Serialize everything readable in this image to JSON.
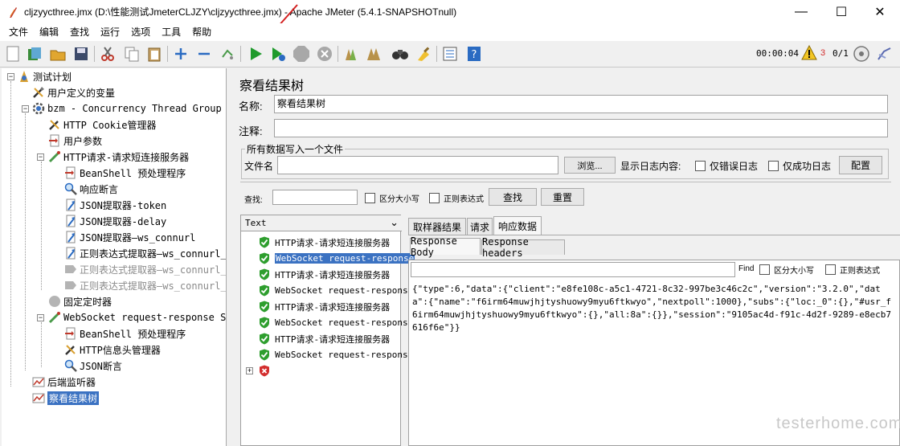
{
  "window": {
    "title": "cljzyycthree.jmx (D:\\性能测试JmeterCLJZY\\cljzyycthree.jmx) - Apache JMeter (5.4.1-SNAPSHOTnull)",
    "min": "—",
    "max": "☐",
    "close": "✕"
  },
  "menu": [
    "文件",
    "编辑",
    "查找",
    "运行",
    "选项",
    "工具",
    "帮助"
  ],
  "toolbar": {
    "timer": "00:00:04",
    "warning_count": "3",
    "threads": "0/1"
  },
  "tree": [
    {
      "label": "测试计划",
      "icon": "test-plan-icon"
    },
    {
      "label": "用户定义的变量",
      "icon": "wrench-icon"
    },
    {
      "label": "bzm - Concurrency Thread Group",
      "icon": "gear-icon"
    },
    {
      "label": "HTTP Cookie管理器",
      "icon": "wrench-icon"
    },
    {
      "label": "用户参数",
      "icon": "preprocessor-icon"
    },
    {
      "label": "HTTP请求-请求短连接服务器",
      "icon": "sampler-icon"
    },
    {
      "label": "BeanShell 预处理程序",
      "icon": "preprocessor-icon"
    },
    {
      "label": "响应断言",
      "icon": "magnifier-icon"
    },
    {
      "label": "JSON提取器-token",
      "icon": "postprocessor-icon"
    },
    {
      "label": "JSON提取器-delay",
      "icon": "postprocessor-icon"
    },
    {
      "label": "JSON提取器—ws_connurl",
      "icon": "postprocessor-icon"
    },
    {
      "label": "正则表达式提取器—ws_connurl_s",
      "icon": "postprocessor-icon"
    },
    {
      "label": "正则表达式提取器—ws_connurl_s",
      "icon": "postprocessor-disabled-icon"
    },
    {
      "label": "正则表达式提取器—ws_connurl_p",
      "icon": "postprocessor-disabled-icon"
    },
    {
      "label": "固定定时器",
      "icon": "timer-icon"
    },
    {
      "label": "WebSocket request-response Sampler",
      "icon": "sampler-icon"
    },
    {
      "label": "BeanShell 预处理程序",
      "icon": "preprocessor-icon"
    },
    {
      "label": "HTTP信息头管理器",
      "icon": "wrench-icon"
    },
    {
      "label": "JSON断言",
      "icon": "magnifier-icon"
    },
    {
      "label": "后端监听器",
      "icon": "listener-icon"
    },
    {
      "label": "察看结果树",
      "icon": "listener-icon"
    }
  ],
  "panel": {
    "title": "察看结果树",
    "name_label": "名称:",
    "name_value": "察看结果树",
    "comment_label": "注释:",
    "comment_value": "",
    "file_group": "所有数据写入一个文件",
    "filename_label": "文件名",
    "browse": "浏览...",
    "log_label": "显示日志内容:",
    "errors_only": "仅错误日志",
    "success_only": "仅成功日志",
    "configure": "配置",
    "search_label": "查找:",
    "case_sensitive": "区分大小写",
    "regex": "正则表达式",
    "search_button": "查找",
    "reset_button": "重置"
  },
  "results": {
    "renderer": "Text",
    "items": [
      {
        "label": "HTTP请求-请求短连接服务器",
        "status": "success"
      },
      {
        "label": "WebSocket request-response",
        "status": "success"
      },
      {
        "label": "HTTP请求-请求短连接服务器",
        "status": "success"
      },
      {
        "label": "WebSocket request-response",
        "status": "success"
      },
      {
        "label": "HTTP请求-请求短连接服务器",
        "status": "success"
      },
      {
        "label": "WebSocket request-response",
        "status": "success"
      },
      {
        "label": "HTTP请求-请求短连接服务器",
        "status": "success"
      },
      {
        "label": "WebSocket request-response",
        "status": "success"
      },
      {
        "label": "",
        "status": "error"
      }
    ]
  },
  "detail": {
    "tabs": [
      "取样器结果",
      "请求",
      "响应数据"
    ],
    "subtabs": [
      "Response Body",
      "Response headers"
    ],
    "find_label": "Find",
    "case_sensitive": "区分大小写",
    "regex": "正则表达式",
    "response_body": "{\"type\":6,\"data\":{\"client\":\"e8fe108c-a5c1-4721-8c32-997be3c46c2c\",\"version\":\"3.2.0\",\"data\":{\"name\":\"f6irm64muwjhjtyshuowy9myu6ftkwyo\",\"nextpoll\":1000},\"subs\":{\"loc:_0\":{},\"#usr_f6irm64muwjhjtyshuowy9myu6ftkwyo\":{},\"all:8a\":{}},\"session\":\"9105ac4d-f91c-4d2f-9289-e8ecb7616f6e\"}}"
  },
  "watermark": "testerhome.com",
  "colors": {
    "selection": "#3b72c2",
    "success": "#2e9e2e",
    "error": "#d32f2f",
    "run": "#1f9a2c"
  }
}
